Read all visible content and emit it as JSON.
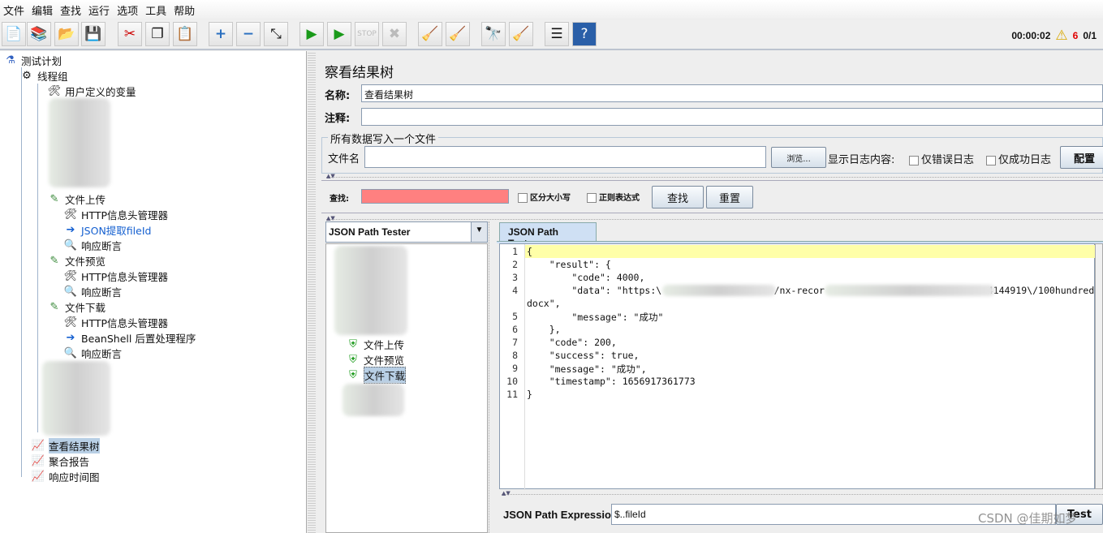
{
  "menu": [
    "文件",
    "编辑",
    "查找",
    "运行",
    "选项",
    "工具",
    "帮助"
  ],
  "toolbar": {
    "icons": [
      "new-icon",
      "templates-icon",
      "open-icon",
      "save-icon",
      "cut-icon",
      "copy-icon",
      "paste-icon",
      "expand-icon",
      "collapse-icon",
      "toggle-icon",
      "start-icon",
      "start-no-pause-icon",
      "stop-icon",
      "shutdown-icon",
      "clear-icon",
      "clear-all-icon",
      "search-icon",
      "reset-search-icon",
      "function-helper-icon",
      "help-icon"
    ]
  },
  "status": {
    "elapsed": "00:00:02",
    "warnings": "6",
    "threads": "0/1"
  },
  "tree": {
    "root": "测试计划",
    "thread_group": "线程组",
    "user_vars": "用户定义的变量",
    "upload": "文件上传",
    "upload_children": [
      "HTTP信息头管理器",
      "JSON提取fileId",
      "响应断言"
    ],
    "preview": "文件预览",
    "preview_children": [
      "HTTP信息头管理器",
      "响应断言"
    ],
    "download": "文件下载",
    "download_children": [
      "HTTP信息头管理器",
      "BeanShell 后置处理程序",
      "响应断言"
    ],
    "listeners": [
      "查看结果树",
      "聚合报告",
      "响应时间图"
    ]
  },
  "panel": {
    "title": "察看结果树",
    "name_label": "名称:",
    "name_value": "查看结果树",
    "comment_label": "注释:",
    "comment_value": "",
    "file_group": "所有数据写入一个文件",
    "filename_label": "文件名",
    "filename_value": "",
    "browse": "浏览...",
    "log_label": "显示日志内容:",
    "errors_only": "仅错误日志",
    "success_only": "仅成功日志",
    "configure": "配置",
    "search_label": "查找:",
    "search_value": "",
    "case_sensitive": "区分大小写",
    "regex": "正则表达式",
    "find": "查找",
    "reset": "重置",
    "renderer": "JSON Path Tester",
    "tab": "JSON Path Tester",
    "results": [
      "文件上传",
      "文件预览",
      "文件下载"
    ],
    "expr_label": "JSON Path Expression",
    "expr_value": "$..fileId",
    "test": "Test"
  },
  "code_lines": [
    {
      "n": "1",
      "t": "{"
    },
    {
      "n": "2",
      "t": "    \"result\": {"
    },
    {
      "n": "3",
      "t": "        \"code\": 4000,"
    },
    {
      "n": "4",
      "t": "        \"data\": \"https:\\                    /nx-recor                             4144919\\/100hundred."
    },
    {
      "n": "",
      "t": "docx\","
    },
    {
      "n": "5",
      "t": "        \"message\": \"成功\""
    },
    {
      "n": "6",
      "t": "    },"
    },
    {
      "n": "7",
      "t": "    \"code\": 200,"
    },
    {
      "n": "8",
      "t": "    \"success\": true,"
    },
    {
      "n": "9",
      "t": "    \"message\": \"成功\","
    },
    {
      "n": "10",
      "t": "    \"timestamp\": 1656917361773"
    },
    {
      "n": "11",
      "t": "}"
    }
  ],
  "watermark": "CSDN @佳期如梦",
  "colors": {
    "search_bg": "#ff8080",
    "highlight_line": "#ffffa8",
    "selection": "#b8cfe5",
    "warning": "#e00000"
  }
}
